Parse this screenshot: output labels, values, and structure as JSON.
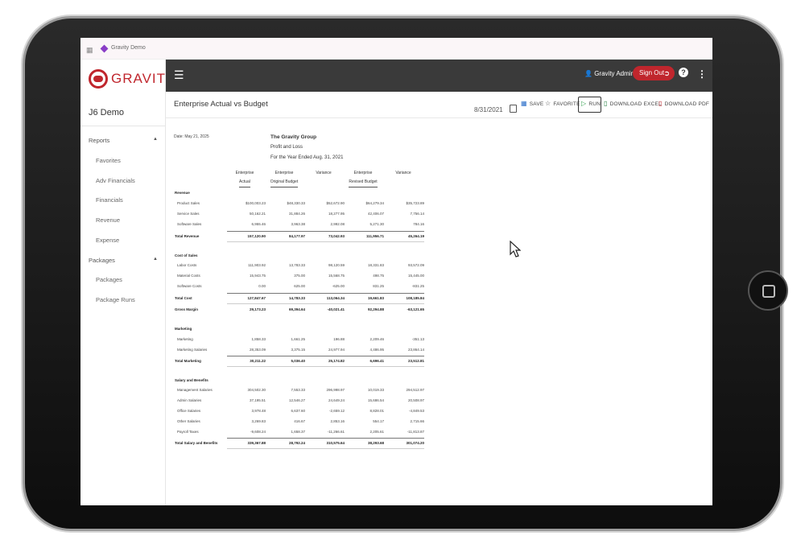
{
  "browser": {
    "tab_title": "Gravity Demo"
  },
  "sidebar": {
    "logo_text": "GRAVITY",
    "app_name": "J6 Demo",
    "sections": [
      {
        "label": "Reports",
        "items": [
          "Favorites",
          "Adv Financials",
          "Financials",
          "Revenue",
          "Expense"
        ]
      },
      {
        "label": "Packages",
        "items": [
          "Packages",
          "Package Runs"
        ]
      }
    ]
  },
  "topbar": {
    "user_name": "Gravity Admin",
    "signout_label": "Sign Out",
    "help_label": "?"
  },
  "toolbar": {
    "title": "Enterprise Actual vs Budget",
    "date": "8/31/2021",
    "save_label": "SAVE",
    "favorite_label": "FAVORITE",
    "run_label": "RUN",
    "excel_label": "DOWNLOAD EXCEL",
    "pdf_label": "DOWNLOAD PDF"
  },
  "report": {
    "date_line": "Date: May 21, 2025",
    "company": "The Gravity Group",
    "subtitle": "Profit and Loss",
    "period": "For the Year Ended Aug. 31, 2021",
    "columns": [
      [
        "Enterprise",
        "Actual"
      ],
      [
        "Enterprise",
        "Original Budget"
      ],
      [
        "Variance",
        ""
      ],
      [
        "Enterprise",
        "Revised Budget"
      ],
      [
        "Variance",
        ""
      ]
    ],
    "rows": [
      {
        "label": "Revenue",
        "type": "section"
      },
      {
        "label": "Product Sales",
        "type": "line",
        "values": [
          "$100,003.23",
          "$48,330.33",
          "$52,672.90",
          "$64,279.34",
          "$35,723.89"
        ]
      },
      {
        "label": "Service Sales",
        "type": "line",
        "values": [
          "50,162.21",
          "31,884.26",
          "18,277.95",
          "42,406.07",
          "7,756.14"
        ]
      },
      {
        "label": "Software Sales",
        "type": "line",
        "values": [
          "6,955.46",
          "3,963.38",
          "2,992.08",
          "5,271.30",
          "784.16"
        ]
      },
      {
        "label": "Total Revenue",
        "type": "total",
        "values": [
          "157,120.90",
          "84,177.97",
          "73,042.93",
          "111,956.71",
          "45,264.19"
        ]
      },
      {
        "label": "Cost of Sales",
        "type": "section"
      },
      {
        "label": "Labor Costs",
        "type": "line",
        "values": [
          "111,903.92",
          "13,783.33",
          "98,120.59",
          "18,331.83",
          "93,572.09"
        ]
      },
      {
        "label": "Material Costs",
        "type": "line",
        "values": [
          "15,943.75",
          "375.00",
          "15,568.75",
          "498.75",
          "15,445.00"
        ]
      },
      {
        "label": "Software Costs",
        "type": "line",
        "values": [
          "0.00",
          "625.00",
          "-625.00",
          "831.25",
          "-831.25"
        ]
      },
      {
        "label": "Total Cost",
        "type": "total",
        "values": [
          "127,847.67",
          "14,783.33",
          "113,064.34",
          "19,661.83",
          "108,185.84"
        ]
      },
      {
        "label": "Gross Margin",
        "type": "total",
        "values": [
          "29,173.23",
          "69,394.64",
          "-40,021.41",
          "92,294.88",
          "-63,121.65"
        ]
      },
      {
        "label": "Marketing",
        "type": "section"
      },
      {
        "label": "Marketing",
        "type": "line",
        "values": [
          "1,858.33",
          "1,661.25",
          "196.88",
          "2,209.46",
          "-351.13"
        ]
      },
      {
        "label": "Marketing Salaries",
        "type": "line",
        "values": [
          "28,353.09",
          "3,375.15",
          "24,977.94",
          "4,486.95",
          "23,864.14"
        ]
      },
      {
        "label": "Total Marketing",
        "type": "total",
        "values": [
          "30,211.22",
          "5,036.40",
          "25,174.82",
          "6,696.41",
          "23,512.81"
        ]
      },
      {
        "label": "Salary and Benefits",
        "type": "section"
      },
      {
        "label": "Management Salaries",
        "type": "line",
        "values": [
          "304,502.30",
          "7,553.33",
          "296,998.97",
          "10,019.33",
          "294,512.97"
        ]
      },
      {
        "label": "Admin Salaries",
        "type": "line",
        "values": [
          "37,195.51",
          "12,546.27",
          "24,649.24",
          "15,686.54",
          "20,508.97"
        ]
      },
      {
        "label": "Office Salaries",
        "type": "line",
        "values": [
          "3,978.48",
          "6,637.60",
          "-2,659.12",
          "8,828.01",
          "-4,849.53"
        ]
      },
      {
        "label": "Other Salaries",
        "type": "line",
        "values": [
          "3,269.83",
          "416.67",
          "2,853.16",
          "554.17",
          "2,715.66"
        ]
      },
      {
        "label": "Payroll Taxes",
        "type": "line",
        "values": [
          "-9,608.24",
          "1,658.37",
          "-11,266.61",
          "2,205.61",
          "-11,813.87"
        ]
      },
      {
        "label": "Total Salary and Benefits",
        "type": "total",
        "values": [
          "339,367.88",
          "28,792.24",
          "310,575.64",
          "38,293.68",
          "301,074.20"
        ]
      }
    ]
  }
}
